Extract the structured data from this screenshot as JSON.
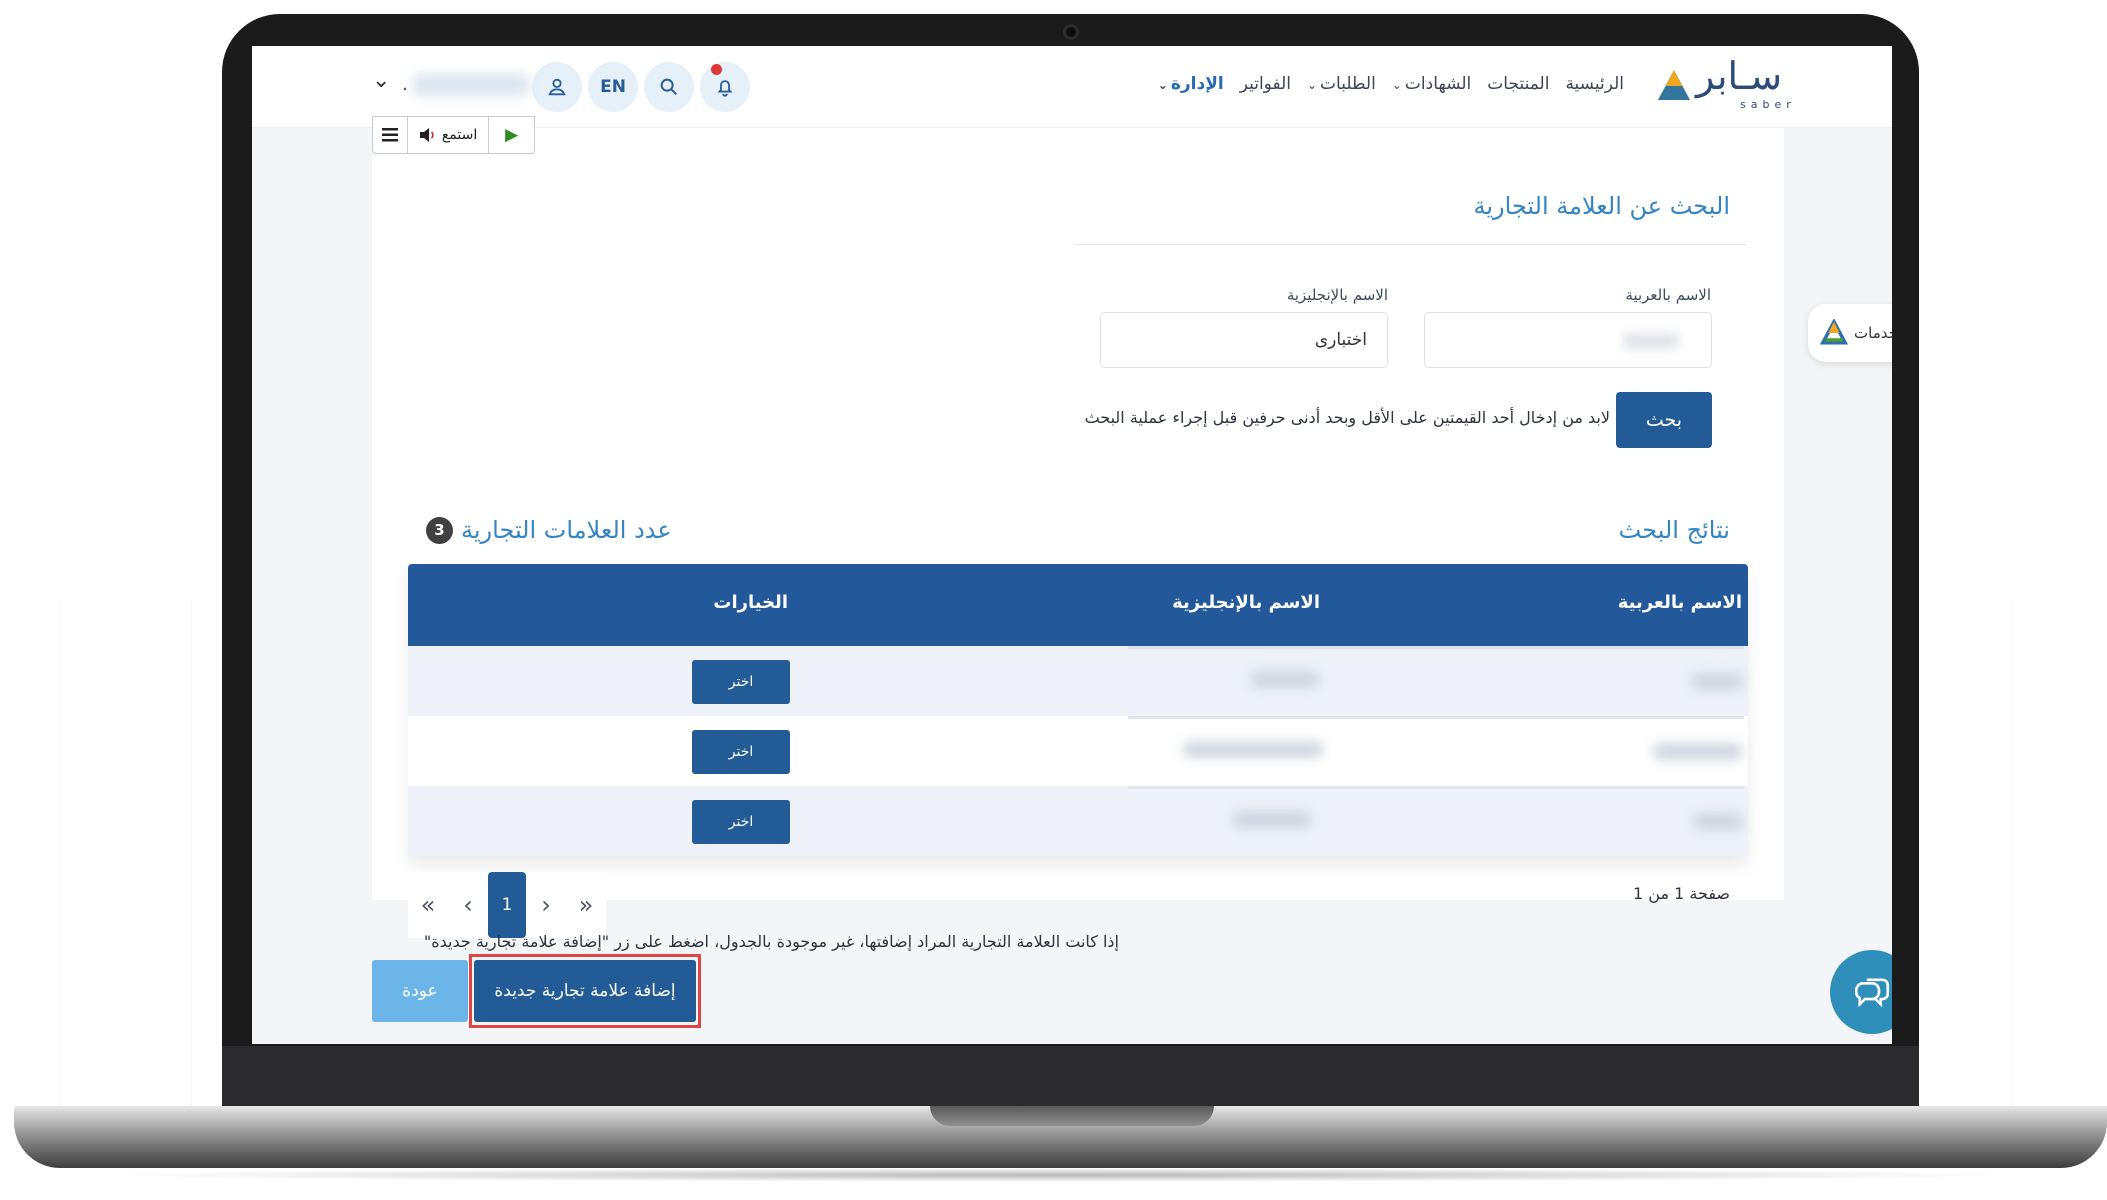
{
  "brand": {
    "name": "سـابر",
    "sub": "saber"
  },
  "nav": {
    "items": [
      {
        "label": "الرئيسية",
        "dropdown": false,
        "active": false
      },
      {
        "label": "المنتجات",
        "dropdown": false,
        "active": false
      },
      {
        "label": "الشهادات",
        "dropdown": true,
        "active": false
      },
      {
        "label": "الطلبات",
        "dropdown": true,
        "active": false
      },
      {
        "label": "الفواتير",
        "dropdown": false,
        "active": false
      },
      {
        "label": "الإدارة",
        "dropdown": true,
        "active": true
      }
    ]
  },
  "header": {
    "language_label": "EN",
    "notification_dot_color": "#e03838"
  },
  "listen_toolbar": {
    "listen_label": "استمع"
  },
  "search": {
    "title": "البحث عن العلامة التجارية",
    "arabic_name_label": "الاسم بالعربية",
    "english_name_label": "الاسم بالإنجليزية",
    "arabic_name_value": "",
    "english_name_value": "اختبارى",
    "search_button": "بحث",
    "hint": "لابد من إدخال أحد القيمتين على الأقل وبحد أدنى حرفين قبل إجراء عملية البحث"
  },
  "results": {
    "title": "نتائج البحث",
    "count_label": "عدد العلامات التجارية",
    "count": "3",
    "columns": [
      "الاسم بالعربية",
      "الاسم بالإنجليزية",
      "الخيارات"
    ],
    "row_action_label": "اختر",
    "rows_count": 3,
    "pagination": {
      "first": "«",
      "prev": "‹",
      "current": "1",
      "next": "›",
      "last": "»"
    },
    "page_info": "صفحة 1 من 1"
  },
  "footer": {
    "note": "إذا كانت العلامة التجارية المراد إضافتها، غير موجودة بالجدول، اضغط على زر \"إضافة علامة تجارية جديدة\"",
    "add_button": "إضافة علامة تجارية جديدة",
    "back_button": "عودة"
  },
  "side_tab": {
    "label": "خدمات"
  },
  "colors": {
    "primary": "#235b97",
    "accent": "#3585c4",
    "back_button": "#6bb5e8",
    "highlight": "#e04545"
  }
}
